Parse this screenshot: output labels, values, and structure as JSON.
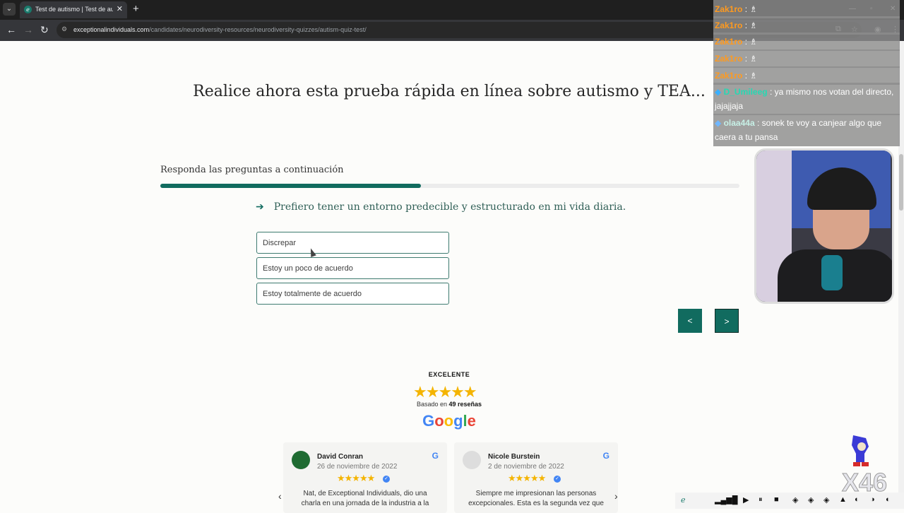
{
  "browser": {
    "tab_title": "Test de autismo | Test de autismo",
    "url_host": "exceptionalindividuals.com",
    "url_path": "/candidates/neurodiversity-resources/neurodiversity-quizzes/autism-quiz-test/"
  },
  "page": {
    "hero_title": "Realice ahora esta prueba rápida en línea sobre autismo y TEA...",
    "quiz_label": "Responda las preguntas a continuación",
    "progress_fraction": 0.45,
    "question": "Prefiero tener un entorno predecible y estructurado en mi vida diaria.",
    "options": [
      "Discrepar",
      "Estoy un poco de acuerdo",
      "Estoy totalmente de acuerdo"
    ],
    "prev_label": "<",
    "next_label": ">"
  },
  "reviews_widget": {
    "rating_word": "EXCELENTE",
    "stars": "★★★★★",
    "based_on_prefix": "Basado en",
    "based_on_count": "49 reseñas",
    "google": [
      "G",
      "o",
      "o",
      "g",
      "l",
      "e"
    ],
    "reviews": [
      {
        "name": "David Conran",
        "date": "26 de noviembre de 2022",
        "stars": "★★★★★",
        "text": "Nat, de Exceptional Individuals, dio una charla en una jornada de la industria a la"
      },
      {
        "name": "Nicole Burstein",
        "date": "2 de noviembre de 2022",
        "stars": "★★★★★",
        "text": "Siempre me impresionan las personas excepcionales. Esta es la segunda vez que"
      }
    ]
  },
  "chat": [
    {
      "user": "Zak1ro",
      "msg": "♗"
    },
    {
      "user": "Zak1ro",
      "msg": "♗"
    },
    {
      "user": "Zak1ro",
      "msg": "♗"
    },
    {
      "user": "Zak1ro",
      "msg": "♗"
    },
    {
      "user": "Zak1ro",
      "msg": "♗"
    },
    {
      "user": "D_Umileeg",
      "msg": "ya mismo nos votan del directo, jajajjaja"
    },
    {
      "user": "olaa44a",
      "msg": "sonek te voy a canjear algo que caera a tu pansa"
    }
  ],
  "overlay": {
    "watermark": "X46"
  },
  "colors": {
    "accent": "#116b5f",
    "star": "#f4b400"
  }
}
